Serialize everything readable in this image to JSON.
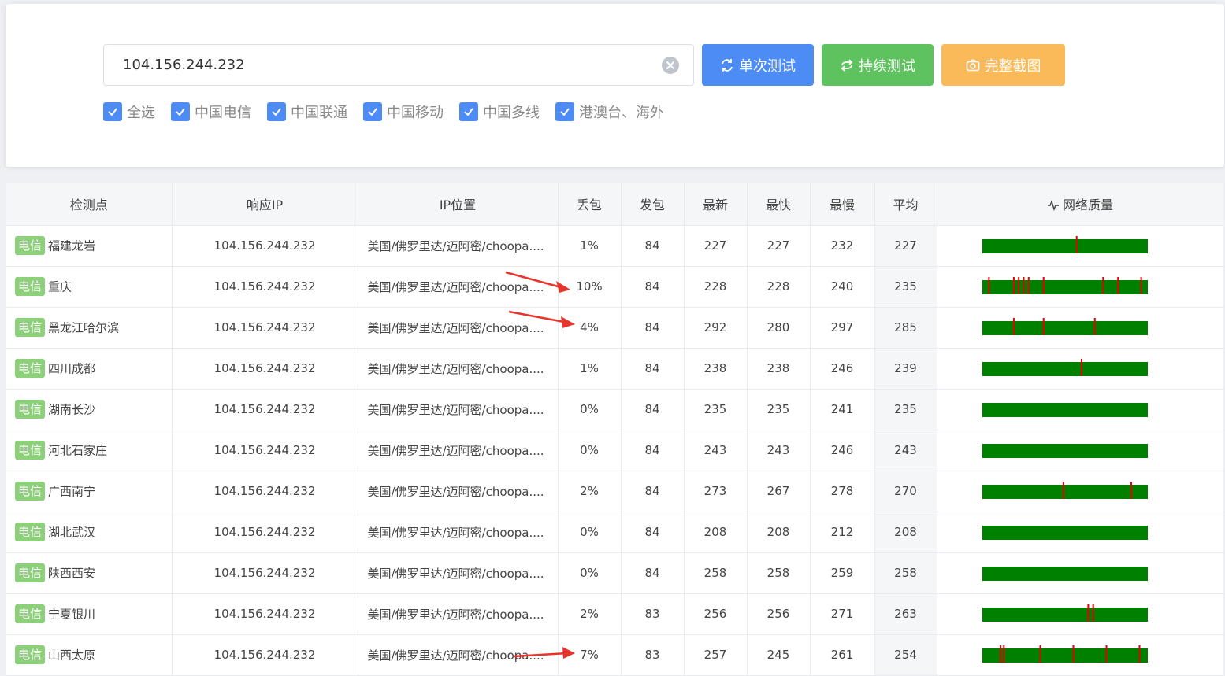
{
  "search": {
    "value": "104.156.244.232"
  },
  "buttons": {
    "single": "单次测试",
    "continuous": "持续测试",
    "screenshot": "完整截图"
  },
  "filters": [
    {
      "label": "全选",
      "checked": true
    },
    {
      "label": "中国电信",
      "checked": true
    },
    {
      "label": "中国联通",
      "checked": true
    },
    {
      "label": "中国移动",
      "checked": true
    },
    {
      "label": "中国多线",
      "checked": true
    },
    {
      "label": "港澳台、海外",
      "checked": true
    }
  ],
  "table": {
    "headers": [
      "检测点",
      "响应IP",
      "IP位置",
      "丢包",
      "发包",
      "最新",
      "最快",
      "最慢",
      "平均",
      "网络质量"
    ],
    "rows": [
      {
        "tag": "电信",
        "site": "福建龙岩",
        "ip": "104.156.244.232",
        "loc": "美国/佛罗里达/迈阿密/choopa....",
        "loss": "1%",
        "sent": "84",
        "latest": "227",
        "fast": "227",
        "slow": "232",
        "avg": "227",
        "quality": [
          0.57
        ]
      },
      {
        "tag": "电信",
        "site": "重庆",
        "ip": "104.156.244.232",
        "loc": "美国/佛罗里达/迈阿密/choopa....",
        "loss": "10%",
        "sent": "84",
        "latest": "228",
        "fast": "228",
        "slow": "240",
        "avg": "235",
        "quality": [
          0.04,
          0.19,
          0.22,
          0.25,
          0.28,
          0.37,
          0.73,
          0.82,
          0.96
        ]
      },
      {
        "tag": "电信",
        "site": "黑龙江哈尔滨",
        "ip": "104.156.244.232",
        "loc": "美国/佛罗里达/迈阿密/choopa....",
        "loss": "4%",
        "sent": "84",
        "latest": "292",
        "fast": "280",
        "slow": "297",
        "avg": "285",
        "quality": [
          0.19,
          0.37,
          0.68
        ]
      },
      {
        "tag": "电信",
        "site": "四川成都",
        "ip": "104.156.244.232",
        "loc": "美国/佛罗里达/迈阿密/choopa....",
        "loss": "1%",
        "sent": "84",
        "latest": "238",
        "fast": "238",
        "slow": "246",
        "avg": "239",
        "quality": [
          0.6
        ]
      },
      {
        "tag": "电信",
        "site": "湖南长沙",
        "ip": "104.156.244.232",
        "loc": "美国/佛罗里达/迈阿密/choopa....",
        "loss": "0%",
        "sent": "84",
        "latest": "235",
        "fast": "235",
        "slow": "241",
        "avg": "235",
        "quality": []
      },
      {
        "tag": "电信",
        "site": "河北石家庄",
        "ip": "104.156.244.232",
        "loc": "美国/佛罗里达/迈阿密/choopa....",
        "loss": "0%",
        "sent": "84",
        "latest": "243",
        "fast": "243",
        "slow": "246",
        "avg": "243",
        "quality": []
      },
      {
        "tag": "电信",
        "site": "广西南宁",
        "ip": "104.156.244.232",
        "loc": "美国/佛罗里达/迈阿密/choopa....",
        "loss": "2%",
        "sent": "84",
        "latest": "273",
        "fast": "267",
        "slow": "278",
        "avg": "270",
        "quality": [
          0.49,
          0.9
        ]
      },
      {
        "tag": "电信",
        "site": "湖北武汉",
        "ip": "104.156.244.232",
        "loc": "美国/佛罗里达/迈阿密/choopa....",
        "loss": "0%",
        "sent": "84",
        "latest": "208",
        "fast": "208",
        "slow": "212",
        "avg": "208",
        "quality": []
      },
      {
        "tag": "电信",
        "site": "陕西西安",
        "ip": "104.156.244.232",
        "loc": "美国/佛罗里达/迈阿密/choopa....",
        "loss": "0%",
        "sent": "84",
        "latest": "258",
        "fast": "258",
        "slow": "259",
        "avg": "258",
        "quality": []
      },
      {
        "tag": "电信",
        "site": "宁夏银川",
        "ip": "104.156.244.232",
        "loc": "美国/佛罗里达/迈阿密/choopa....",
        "loss": "2%",
        "sent": "83",
        "latest": "256",
        "fast": "256",
        "slow": "271",
        "avg": "263",
        "quality": [
          0.64,
          0.67
        ]
      },
      {
        "tag": "电信",
        "site": "山西太原",
        "ip": "104.156.244.232",
        "loc": "美国/佛罗里达/迈阿密/choopa....",
        "loss": "7%",
        "sent": "83",
        "latest": "257",
        "fast": "245",
        "slow": "261",
        "avg": "254",
        "quality": [
          0.11,
          0.13,
          0.35,
          0.55,
          0.75,
          0.95
        ]
      }
    ]
  },
  "colors": {
    "quality_ok": "#008000",
    "quality_loss": "#e60000",
    "accent": "#4d8bf5"
  }
}
